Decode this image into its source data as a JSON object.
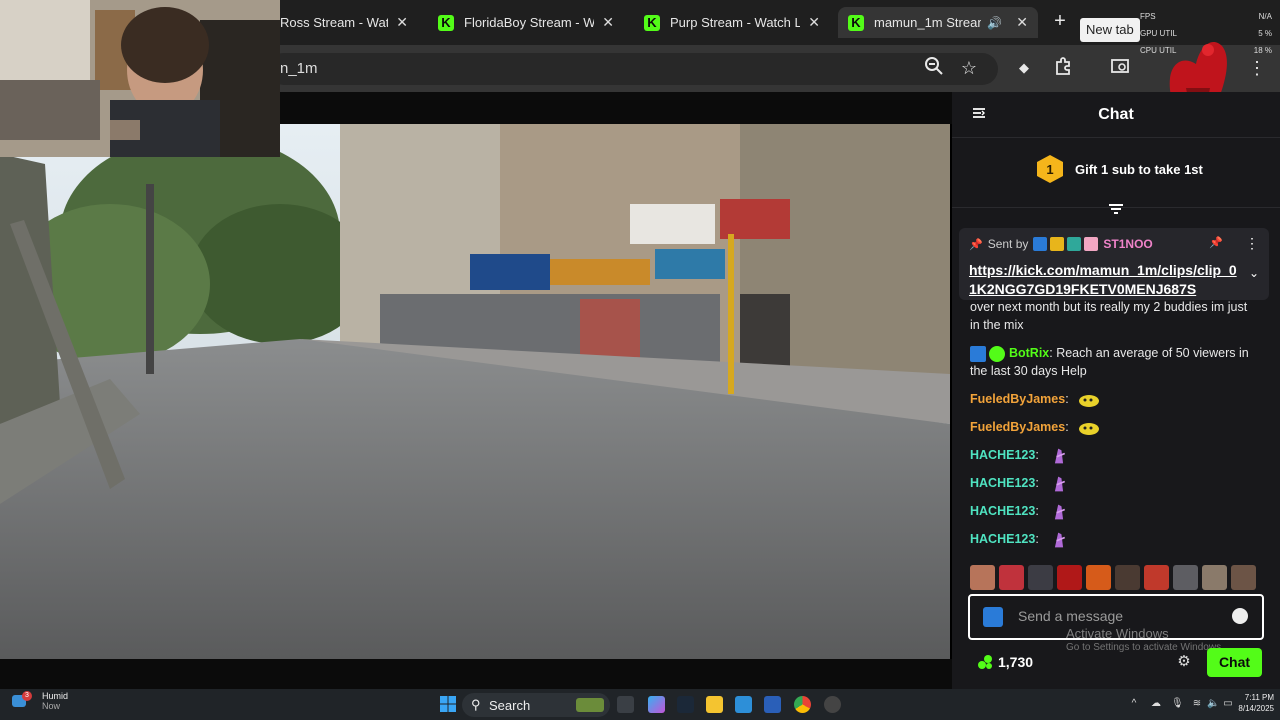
{
  "browser": {
    "tabs": [
      {
        "title": "Ross Stream - Wat"
      },
      {
        "title": "FloridaBoy Stream - W"
      },
      {
        "title": "Purp Stream - Watch L"
      },
      {
        "title": "mamun_1m Stream"
      }
    ],
    "new_tab_tooltip": "New tab",
    "url_fragment": "n_1m"
  },
  "perf_overlay": {
    "rows": [
      {
        "label": "FPS",
        "value": "N/A"
      },
      {
        "label": "GPU UTIL",
        "value": "5 %"
      },
      {
        "label": "CPU UTIL",
        "value": "18 %"
      }
    ]
  },
  "chat": {
    "title": "Chat",
    "gift": {
      "badge_number": "1",
      "text": "Gift 1 sub to take 1st"
    },
    "pinned": {
      "sent_by_label": "Sent by",
      "sender": "ST1NOO",
      "link": "https://kick.com/mamun_1m/clips/clip_01K2NGG7GD19FKETV0MENJ687S"
    },
    "partial_message": "over next month but its really my 2 buddies im just in the mix",
    "messages": [
      {
        "user": "BotRix",
        "text": "Reach an average of 50 viewers in the last 30 days Help",
        "color": "#53fc18"
      },
      {
        "user": "FueledByJames",
        "text": "",
        "color": "#f2a33a"
      },
      {
        "user": "FueledByJames",
        "text": "",
        "color": "#f2a33a"
      },
      {
        "user": "HACHE123",
        "text": "",
        "color": "#4fe3c1"
      },
      {
        "user": "HACHE123",
        "text": "",
        "color": "#4fe3c1"
      },
      {
        "user": "HACHE123",
        "text": "",
        "color": "#4fe3c1"
      },
      {
        "user": "HACHE123",
        "text": "",
        "color": "#4fe3c1"
      }
    ],
    "input_placeholder": "Send a message",
    "points": "1,730",
    "send_label": "Chat"
  },
  "windows": {
    "activate_title": "Activate Windows",
    "activate_sub": "Go to Settings to activate Windows.",
    "weather_label": "Humid",
    "weather_sub": "Now",
    "notification_count": "3",
    "search_label": "Search",
    "time": "7:11 PM",
    "date": "8/14/2025"
  },
  "colors": {
    "kick_green": "#53fc18",
    "chat_bg": "#18181b",
    "pinned_bg": "#26262b"
  }
}
